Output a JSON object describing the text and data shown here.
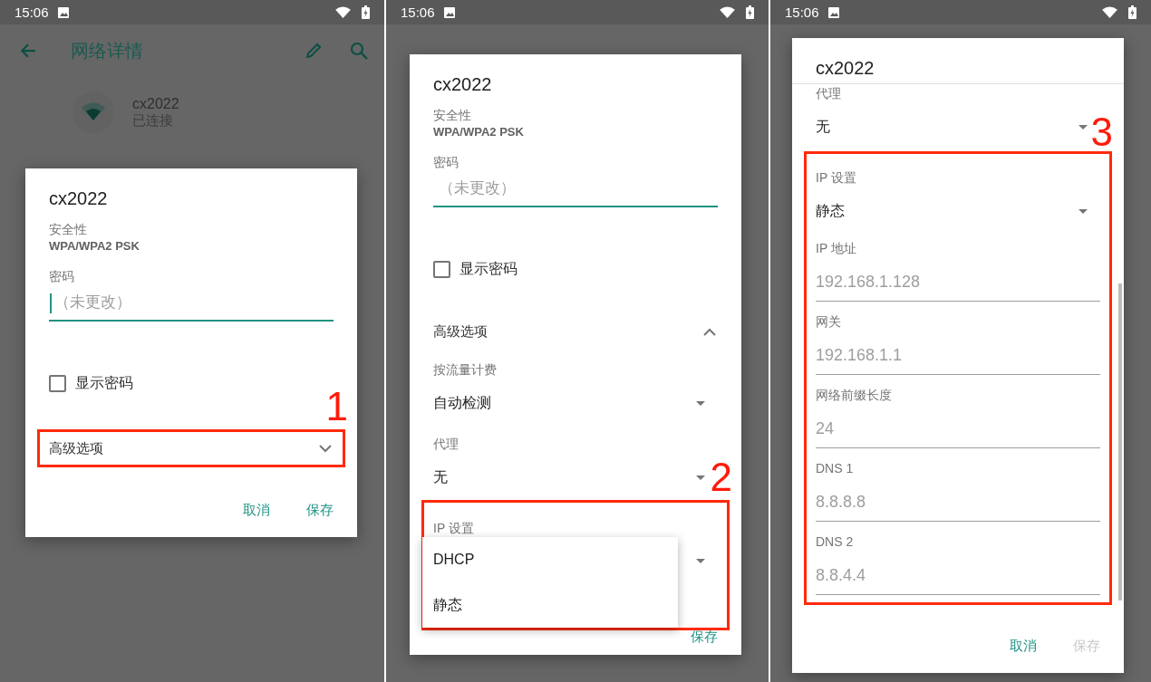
{
  "panels": [
    {
      "status_bar": {
        "time": "15:06"
      },
      "app_bar": {
        "title": "网络详情"
      },
      "network": {
        "name": "cx2022",
        "status": "已连接"
      },
      "dialog": {
        "title": "cx2022",
        "scrolled": false,
        "sections": [
          {
            "kind": "plain",
            "rows": [
              {
                "kind": "info",
                "label": "安全性",
                "value": "WPA/WPA2 PSK"
              },
              {
                "kind": "password",
                "label": "密码",
                "placeholder": "（未更改）",
                "focused": true
              },
              {
                "kind": "checkbox",
                "label": "显示密码",
                "checked": false
              }
            ]
          },
          {
            "kind": "annotated",
            "number": "1",
            "rows": [
              {
                "kind": "expander",
                "label": "高级选项",
                "expanded": false
              }
            ]
          }
        ],
        "buttons": [
          {
            "label": "取消",
            "disabled": false
          },
          {
            "label": "保存",
            "disabled": false
          }
        ]
      }
    },
    {
      "status_bar": {
        "time": "15:06"
      },
      "dialog": {
        "title": "cx2022",
        "scrolled": false,
        "sections": [
          {
            "kind": "plain",
            "rows": [
              {
                "kind": "info",
                "label": "安全性",
                "value": "WPA/WPA2 PSK"
              },
              {
                "kind": "password",
                "label": "密码",
                "placeholder": "（未更改）",
                "focused": false
              },
              {
                "kind": "checkbox",
                "label": "显示密码",
                "checked": false
              },
              {
                "kind": "expander",
                "label": "高级选项",
                "expanded": true
              },
              {
                "kind": "spinner",
                "label": "按流量计费",
                "value": "自动检测"
              },
              {
                "kind": "spinner",
                "label": "代理",
                "value": "无"
              }
            ]
          },
          {
            "kind": "annotated",
            "number": "2",
            "rows": [
              {
                "kind": "spinner",
                "label": "IP 设置",
                "menu": [
                  {
                    "label": "DHCP"
                  },
                  {
                    "label": "静态"
                  }
                ]
              }
            ]
          }
        ],
        "buttons": [
          {
            "label": "保存",
            "disabled": false
          }
        ]
      }
    },
    {
      "status_bar": {
        "time": "15:06"
      },
      "dialog": {
        "title": "cx2022",
        "scrolled": true,
        "sections": [
          {
            "kind": "plain",
            "rows": [
              {
                "kind": "spinner",
                "label": "代理",
                "value": "无"
              }
            ]
          },
          {
            "kind": "annotated",
            "number": "3",
            "rows": [
              {
                "kind": "spinner",
                "label": "IP 设置",
                "value": "静态"
              },
              {
                "kind": "text_field",
                "label": "IP 地址",
                "placeholder": "192.168.1.128"
              },
              {
                "kind": "text_field",
                "label": "网关",
                "placeholder": "192.168.1.1"
              },
              {
                "kind": "text_field",
                "label": "网络前缀长度",
                "placeholder": "24"
              },
              {
                "kind": "text_field",
                "label": "DNS 1",
                "placeholder": "8.8.8.8"
              },
              {
                "kind": "text_field",
                "label": "DNS 2",
                "placeholder": "8.8.4.4"
              }
            ]
          }
        ],
        "buttons": [
          {
            "label": "取消",
            "disabled": false
          },
          {
            "label": "保存",
            "disabled": true
          }
        ]
      }
    }
  ]
}
